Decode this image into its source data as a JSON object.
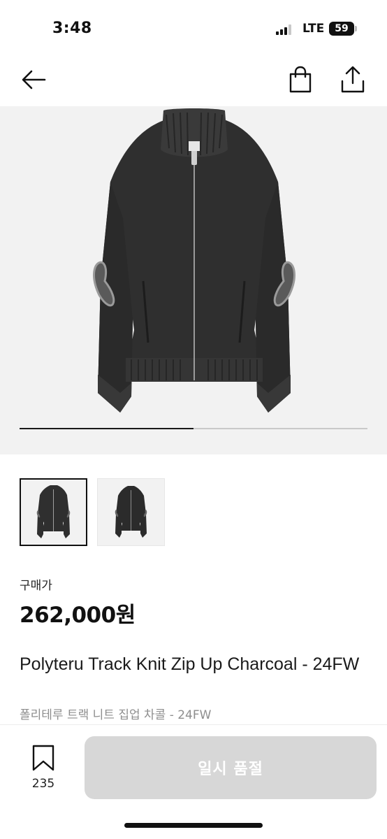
{
  "status_bar": {
    "time": "3:48",
    "network": "LTE",
    "battery": "59"
  },
  "nav": {
    "back_icon": "arrow-left-icon",
    "bag_icon": "shopping-bag-icon",
    "share_icon": "share-icon"
  },
  "gallery": {
    "image_count": 2,
    "current_index": 1,
    "progress": 0.5
  },
  "product": {
    "price_label": "구매가",
    "price": "262,000원",
    "title": "Polyteru Track Knit Zip Up Charcoal - 24FW",
    "subtitle": "폴리테루 트랙 니트 집업 차콜 - 24FW"
  },
  "bottom_bar": {
    "wish_count": "235",
    "soldout_label": "일시 품절"
  },
  "colors": {
    "soldout_bg": "#d7d7d7",
    "subtitle": "#8e8e8e",
    "image_bg": "#f2f2f2"
  }
}
